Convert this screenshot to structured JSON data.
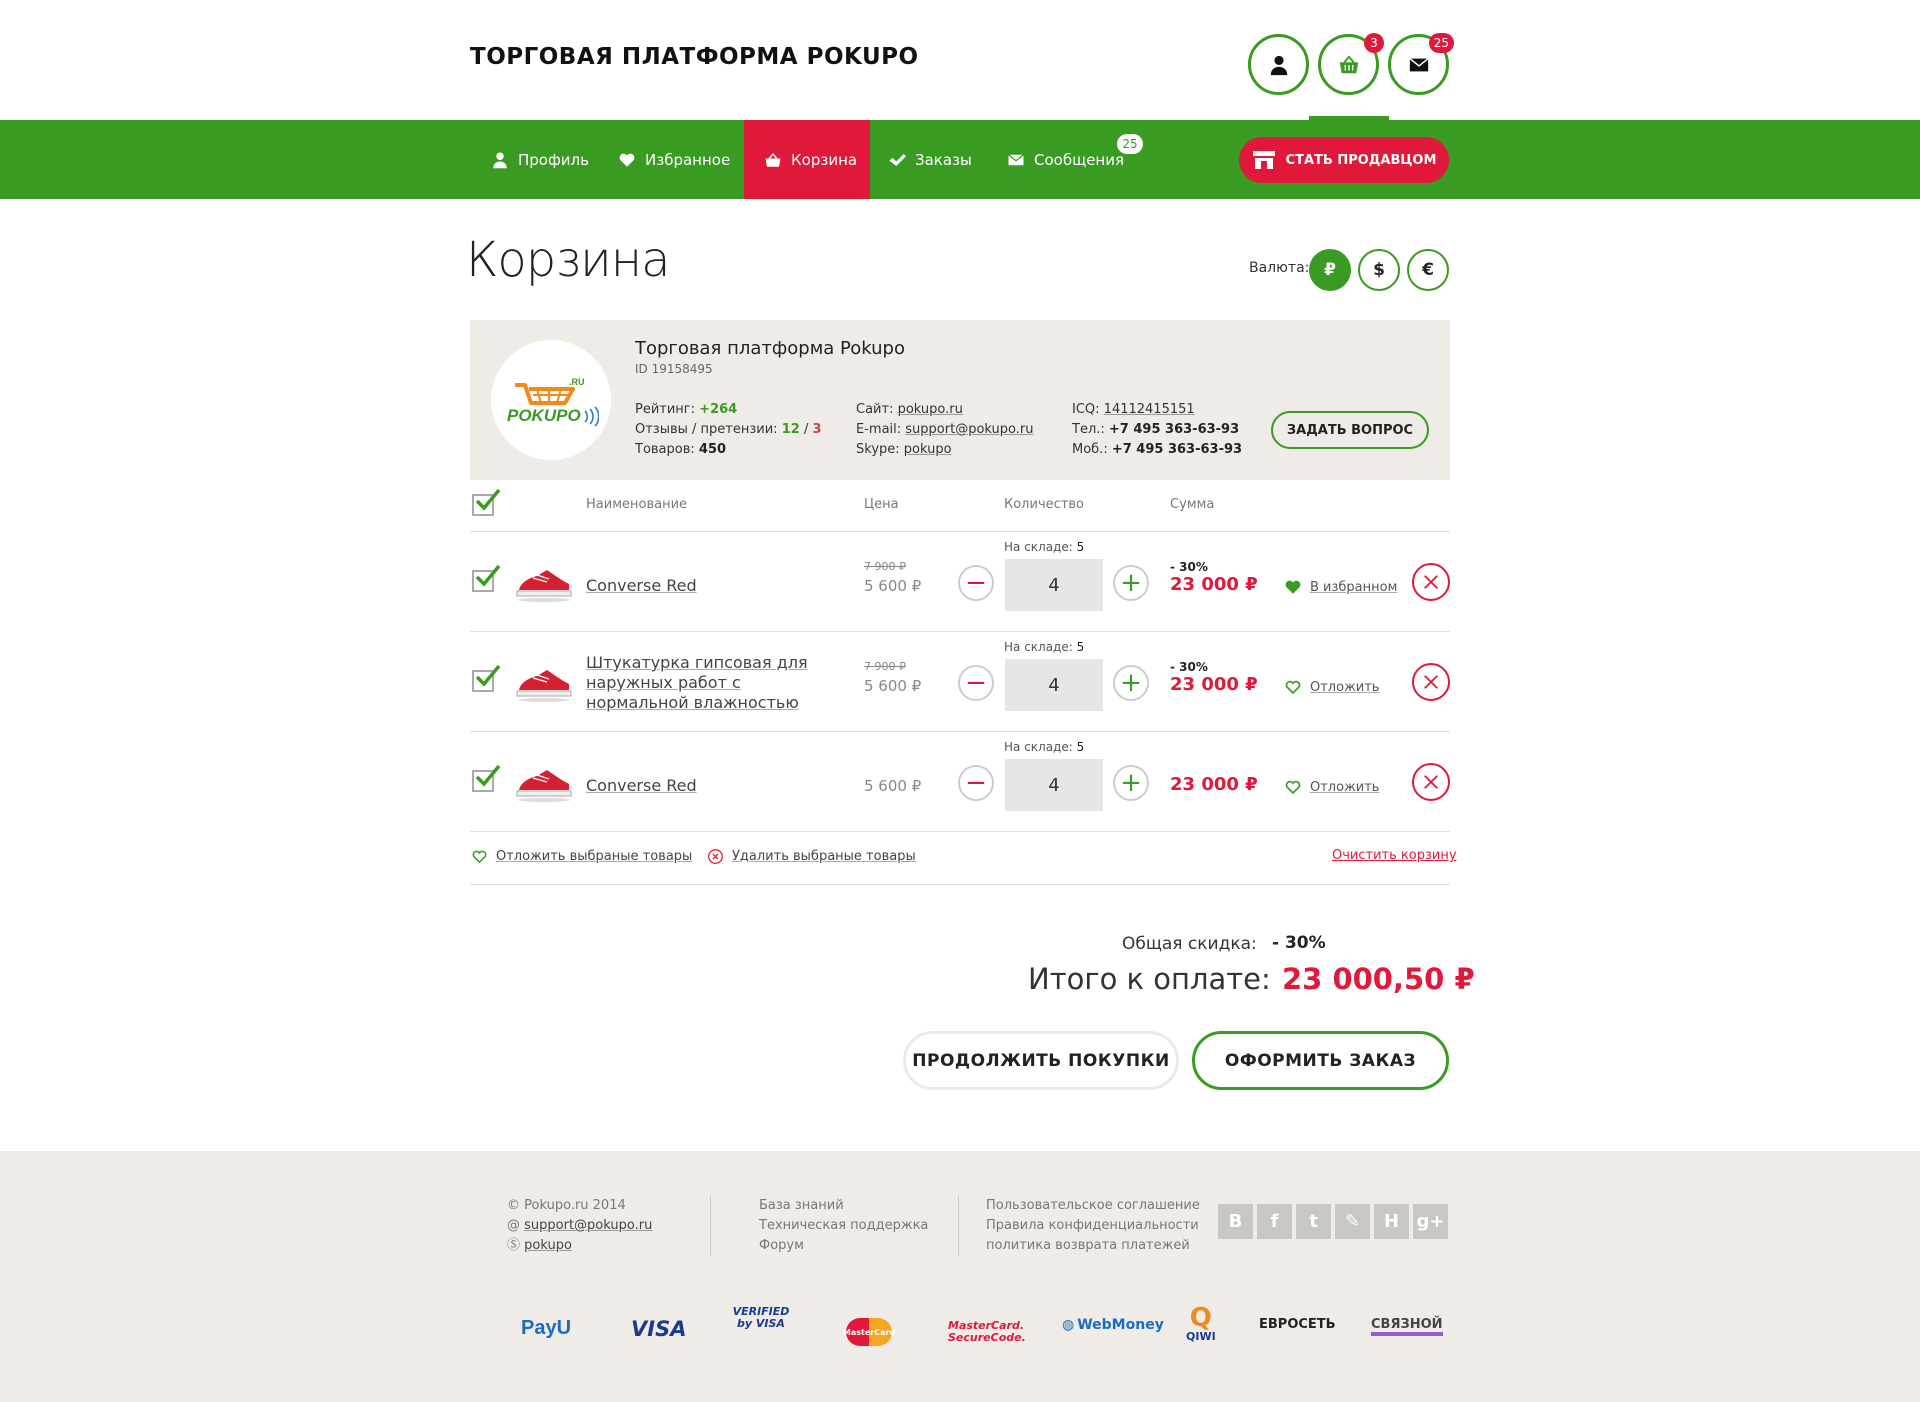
{
  "header": {
    "brand": "ТОРГОВАЯ ПЛАТФОРМА POKUPO",
    "cart_badge": "3",
    "messages_badge": "25"
  },
  "nav": {
    "items": [
      {
        "label": "Профиль",
        "icon": "user-icon"
      },
      {
        "label": "Избранное",
        "icon": "heart-icon"
      },
      {
        "label": "Корзина",
        "icon": "basket-icon",
        "active": true
      },
      {
        "label": "Заказы",
        "icon": "check-icon"
      },
      {
        "label": "Сообщения",
        "icon": "envelope-icon",
        "badge": "25"
      }
    ],
    "seller_button": "СТАТЬ ПРОДАВЦОМ"
  },
  "page": {
    "title": "Корзина",
    "currency_label": "Валюта:",
    "currencies": [
      "₽",
      "$",
      "€"
    ],
    "active_currency": "₽"
  },
  "seller": {
    "name": "Торговая платформа Pokupo",
    "id": "ID 19158495",
    "rating_label": "Рейтинг:",
    "rating_value": "+264",
    "reviews_label": "Отзывы / претензии:",
    "reviews_positive": "12",
    "reviews_sep": "/",
    "reviews_negative": "3",
    "goods_label": "Товаров:",
    "goods_value": "450",
    "site_label": "Сайт:",
    "site_value": "pokupo.ru",
    "email_label": "E-mail:",
    "email_value": "support@pokupo.ru",
    "skype_label": "Skype:",
    "skype_value": "pokupo",
    "icq_label": "ICQ:",
    "icq_value": "14112415151",
    "phone_label": "Тел.:",
    "phone_value": "+7 495 363-63-93",
    "mobile_label": "Моб.:",
    "mobile_value": "+7 495 363-63-93",
    "ask_button": "ЗАДАТЬ ВОПРОС",
    "logo_text": "POKUPO",
    "logo_suffix": ".RU"
  },
  "table": {
    "headers": {
      "name": "Наименование",
      "price": "Цена",
      "qty": "Количество",
      "sum": "Сумма"
    },
    "stock_label": "На складе:",
    "rows": [
      {
        "name": "Converse Red",
        "old_price": "7 900 ₽",
        "price": "5 600 ₽",
        "stock": "5",
        "qty": "4",
        "discount": "- 30%",
        "sum": "23 000 ₽",
        "fav_label": "В избранном",
        "in_fav": true
      },
      {
        "name": "Штукатурка гипсовая для наружных работ с нормальной влажностью",
        "old_price": "7 900 ₽",
        "price": "5 600 ₽",
        "stock": "5",
        "qty": "4",
        "discount": "- 30%",
        "sum": "23 000 ₽",
        "fav_label": "Отложить",
        "in_fav": false
      },
      {
        "name": "Converse Red",
        "old_price": "",
        "price": "5 600 ₽",
        "stock": "5",
        "qty": "4",
        "discount": "",
        "sum": "23 000 ₽",
        "fav_label": "Отложить",
        "in_fav": false
      }
    ]
  },
  "actions": {
    "postpone_selected": "Отложить выбраные товары",
    "delete_selected": "Удалить выбраные товары",
    "clear_cart": "Очистить корзину"
  },
  "totals": {
    "discount_label": "Общая скидка:",
    "discount_value": "- 30%",
    "total_label": "Итого к оплате:",
    "total_value": "23 000,50 ₽",
    "continue_button": "ПРОДОЛЖИТЬ ПОКУПКИ",
    "checkout_button": "ОФОРМИТЬ ЗАКАЗ"
  },
  "footer": {
    "copyright": "Pokupo.ru 2014",
    "email": "support@pokupo.ru",
    "skype": "pokupo",
    "links1": [
      "База знаний",
      "Техническая поддержка",
      "Форум"
    ],
    "links2": [
      "Пользовательское соглашение",
      "Правила конфиденциальности",
      "политика возврата платежей"
    ],
    "social": [
      "B",
      "f",
      "t",
      "✎",
      "Н",
      "g+"
    ],
    "payments": [
      "PayU",
      "VISA",
      "VERIFIED by VISA",
      "MasterCard",
      "MasterCard. SecureCode.",
      "WebMoney",
      "QIWI",
      "ЕВРОСЕТЬ",
      "СВЯЗНОЙ"
    ]
  },
  "colors": {
    "green": "#3a9b22",
    "red": "#e0193a",
    "panel": "#efece8"
  }
}
